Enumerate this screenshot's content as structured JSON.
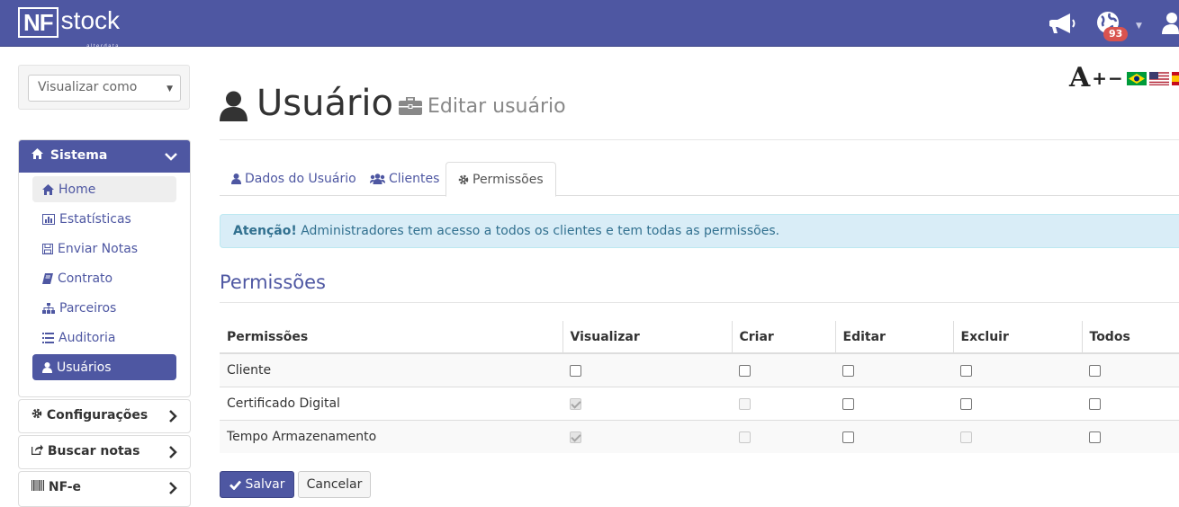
{
  "app": {
    "logo_box": "NF",
    "logo_text": "stock",
    "logo_sub": "alterdata",
    "notification_count": "93"
  },
  "sidebar": {
    "view_as_placeholder": "Visualizar como",
    "sistema": {
      "label": "Sistema",
      "items": [
        {
          "label": "Home",
          "icon": "home-icon"
        },
        {
          "label": "Estatísticas",
          "icon": "bar-chart-icon"
        },
        {
          "label": "Enviar Notas",
          "icon": "save-icon"
        },
        {
          "label": "Contrato",
          "icon": "book-icon"
        },
        {
          "label": "Parceiros",
          "icon": "sitemap-icon"
        },
        {
          "label": "Auditoria",
          "icon": "list-icon"
        },
        {
          "label": "Usuários",
          "icon": "user-icon"
        }
      ]
    },
    "configuracoes": "Configurações",
    "buscar_notas": "Buscar notas",
    "nfe": "NF-e"
  },
  "toolbar": {
    "font_increase": "A",
    "font_plus_minus": "+−"
  },
  "page": {
    "title": "Usuário",
    "subtitle": "Editar usuário"
  },
  "tabs": [
    {
      "label": "Dados do Usuário",
      "icon": "user-icon"
    },
    {
      "label": "Clientes",
      "icon": "users-icon"
    },
    {
      "label": "Permissões",
      "icon": "gear-icon"
    }
  ],
  "alert": {
    "strong": "Atenção!",
    "text": " Administradores tem acesso a todos os clientes e tem todas as permissões."
  },
  "permissions": {
    "heading": "Permissões",
    "columns": [
      "Permissões",
      "Visualizar",
      "Criar",
      "Editar",
      "Excluir",
      "Todos"
    ],
    "rows": [
      {
        "name": "Cliente",
        "states": [
          "unchecked",
          "unchecked",
          "unchecked",
          "unchecked",
          "unchecked"
        ]
      },
      {
        "name": "Certificado Digital",
        "states": [
          "checked-disabled",
          "disabled",
          "unchecked",
          "unchecked",
          "unchecked"
        ]
      },
      {
        "name": "Tempo Armazenamento",
        "states": [
          "checked-disabled",
          "disabled",
          "unchecked",
          "disabled",
          "unchecked"
        ]
      }
    ]
  },
  "buttons": {
    "save": "Salvar",
    "cancel": "Cancelar"
  }
}
